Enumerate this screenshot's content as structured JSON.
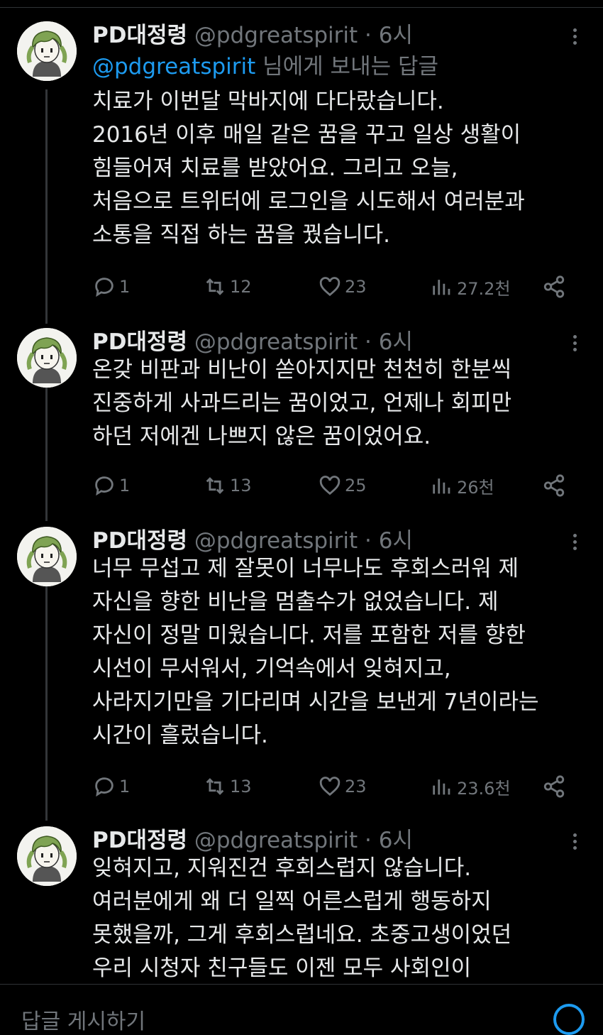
{
  "tweets": [
    {
      "name": "PD대정령",
      "handle": "@pdgreatspirit",
      "dot": "·",
      "time": "6시",
      "reply_mention": "@pdgreatspirit",
      "reply_suffix": " 님에게 보내는 답글",
      "lines": [
        "치료가 이번달 막바지에 다다랐습니다.",
        "2016년 이후 매일 같은 꿈을 꾸고 일상 생활이",
        "힘들어져 치료를 받았어요. 그리고 오늘,",
        "처음으로 트위터에 로그인을 시도해서 여러분과",
        "소통을 직접 하는 꿈을 꿨습니다."
      ],
      "replies": "1",
      "retweets": "12",
      "likes": "23",
      "views": "27.2천"
    },
    {
      "name": "PD대정령",
      "handle": "@pdgreatspirit",
      "dot": "·",
      "time": "6시",
      "lines": [
        "온갖 비판과 비난이 쏟아지지만 천천히 한분씩",
        "진중하게 사과드리는 꿈이었고, 언제나 회피만",
        "하던 저에겐 나쁘지 않은 꿈이었어요."
      ],
      "replies": "1",
      "retweets": "13",
      "likes": "25",
      "views": "26천"
    },
    {
      "name": "PD대정령",
      "handle": "@pdgreatspirit",
      "dot": "·",
      "time": "6시",
      "lines": [
        "너무 무섭고 제 잘못이 너무나도 후회스러워 제",
        "자신을 향한 비난을 멈출수가 없었습니다. 제",
        "자신이 정말 미웠습니다. 저를 포함한 저를 향한",
        "시선이 무서워서, 기억속에서 잊혀지고,",
        "사라지기만을 기다리며 시간을 보낸게 7년이라는",
        "시간이 흘렀습니다."
      ],
      "replies": "1",
      "retweets": "13",
      "likes": "23",
      "views": "23.6천"
    },
    {
      "name": "PD대정령",
      "handle": "@pdgreatspirit",
      "dot": "·",
      "time": "6시",
      "lines": [
        "잊혀지고, 지워진건 후회스럽지 않습니다.",
        "여러분에게 왜 더 일찍 어른스럽게 행동하지",
        "못했을까, 그게 후회스럽네요. 초중고생이었던",
        "우리 시청자 친구들도 이젠 모두 사회인이"
      ]
    }
  ],
  "bottom": {
    "text": "답글 게시하기"
  },
  "colors": {
    "background": "#000000",
    "text": "#e7e9ea",
    "muted": "#71767b",
    "link": "#1d9bf0"
  },
  "icons": [
    "reply-icon",
    "retweet-icon",
    "like-icon",
    "views-icon",
    "share-icon",
    "more-icon",
    "avatar"
  ]
}
